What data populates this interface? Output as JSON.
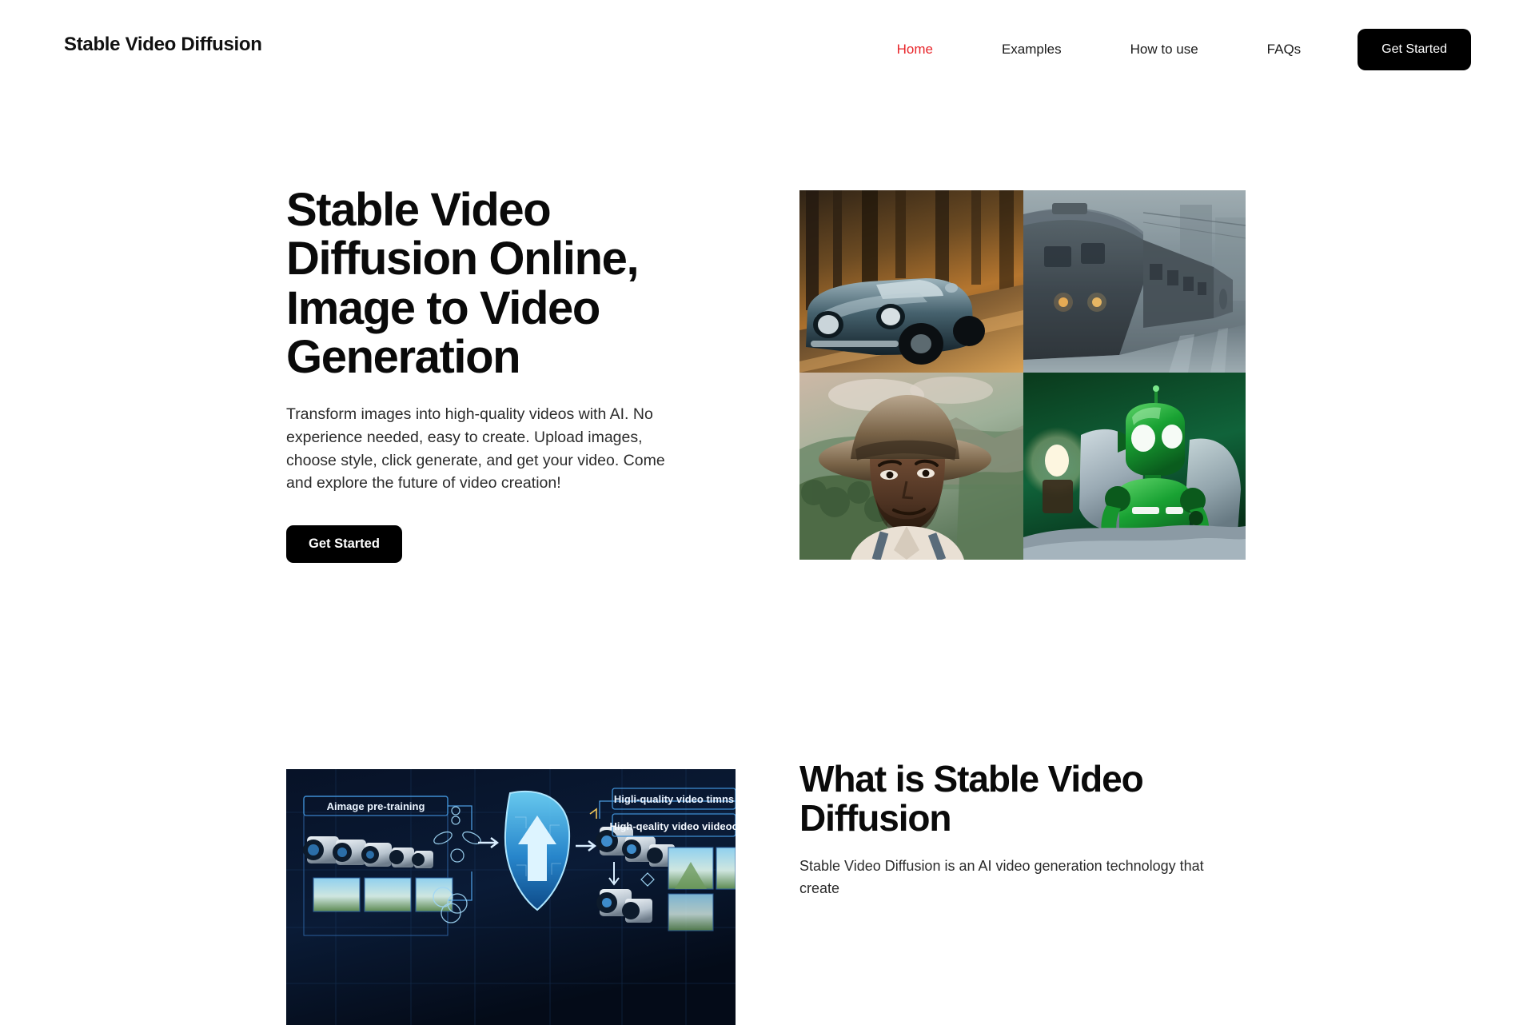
{
  "theme": {
    "accent_red": "#e8252a",
    "button_black": "#000000",
    "text_dark": "#0a0a0a",
    "body_text": "#2b2b2b",
    "page_background": "#ffffff"
  },
  "header": {
    "brand": "Stable Video Diffusion",
    "nav": [
      {
        "label": "Home",
        "active": true
      },
      {
        "label": "Examples",
        "active": false
      },
      {
        "label": "How to use",
        "active": false
      },
      {
        "label": "FAQs",
        "active": false
      }
    ],
    "cta_label": "Get Started"
  },
  "hero": {
    "title": "Stable Video Diffusion Online, Image to Video Generation",
    "subtitle": "Transform images into high-quality videos with AI. No experience needed, easy to create. Upload images, choose style, click generate, and get your video. Come and explore the future of video creation!",
    "cta_label": "Get Started",
    "gallery": [
      {
        "name": "vintage-car-forest-road",
        "caption": "Vintage convertible car driving on a forest road at golden hour"
      },
      {
        "name": "train-in-fog",
        "caption": "Train arriving at a foggy rainy station"
      },
      {
        "name": "cowboy-portrait",
        "caption": "Man in cowboy hat with mountain landscape behind"
      },
      {
        "name": "green-robot-in-bed",
        "caption": "Green toy robot sitting in bed beside a lamp"
      }
    ]
  },
  "what_section": {
    "title": "What is Stable Video Diffusion",
    "body": "Stable Video Diffusion is an AI video generation technology that create",
    "figure": {
      "name": "svd-pipeline-diagram",
      "labels": [
        "Aimage pre-training",
        "Higli-quality video timns",
        "High-qeality video viideoo"
      ]
    }
  }
}
